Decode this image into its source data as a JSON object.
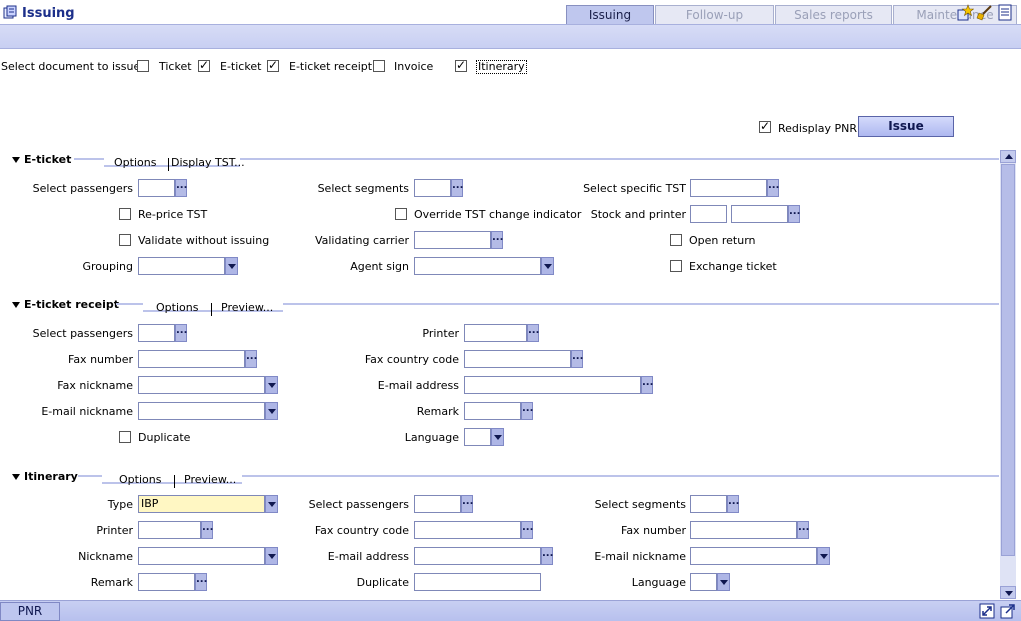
{
  "tabs": [
    {
      "label": "Issuing",
      "active": true
    },
    {
      "label": "Follow-up",
      "active": false
    },
    {
      "label": "Sales reports",
      "active": false
    },
    {
      "label": "Maintenance",
      "active": false
    }
  ],
  "header": {
    "title": "Issuing"
  },
  "doc_select": {
    "label": "Select document to issue:",
    "options": [
      {
        "label": "Ticket",
        "checked": false
      },
      {
        "label": "E-ticket",
        "checked": true
      },
      {
        "label": "E-ticket receipt",
        "checked": true
      },
      {
        "label": "Invoice",
        "checked": false
      },
      {
        "label": "Itinerary",
        "checked": true
      }
    ]
  },
  "redisplay": {
    "label": "Redisplay PNR",
    "checked": true
  },
  "issue_button": "Issue",
  "eticket": {
    "title": "E-ticket",
    "tabs": [
      "Options",
      "Display TST..."
    ],
    "select_passengers": "Select passengers",
    "select_segments": "Select segments",
    "select_specific_tst": "Select specific TST",
    "reprice_tst": "Re-price TST",
    "override_tst": "Override TST change indicator",
    "stock_printer": "Stock and printer",
    "validate_without": "Validate without issuing",
    "validating_carrier": "Validating carrier",
    "open_return": "Open return",
    "grouping": "Grouping",
    "agent_sign": "Agent sign",
    "exchange_ticket": "Exchange ticket"
  },
  "receipt": {
    "title": "E-ticket receipt",
    "tabs": [
      "Options",
      "Preview..."
    ],
    "select_passengers": "Select passengers",
    "printer": "Printer",
    "fax_number": "Fax number",
    "fax_country_code": "Fax country code",
    "fax_nickname": "Fax nickname",
    "email_address": "E-mail address",
    "email_nickname": "E-mail nickname",
    "remark": "Remark",
    "duplicate": "Duplicate",
    "language": "Language"
  },
  "itinerary": {
    "title": "Itinerary",
    "tabs": [
      "Options",
      "Preview..."
    ],
    "type": "Type",
    "type_value": "IBP",
    "select_passengers": "Select passengers",
    "select_segments": "Select segments",
    "printer": "Printer",
    "fax_country_code": "Fax country code",
    "fax_number": "Fax number",
    "nickname": "Nickname",
    "email_address": "E-mail address",
    "email_nickname": "E-mail nickname",
    "remark": "Remark",
    "duplicate": "Duplicate",
    "language": "Language"
  },
  "footer": {
    "pnr_tab": "PNR"
  },
  "colors": {
    "accent": "#bfc7ee",
    "title_text": "#1c2f8a",
    "highlight_field": "#fff7c3"
  },
  "icons": [
    "issuing-icon",
    "star-icon",
    "broom-icon",
    "notepad-icon",
    "expand-icon",
    "popout-icon"
  ]
}
